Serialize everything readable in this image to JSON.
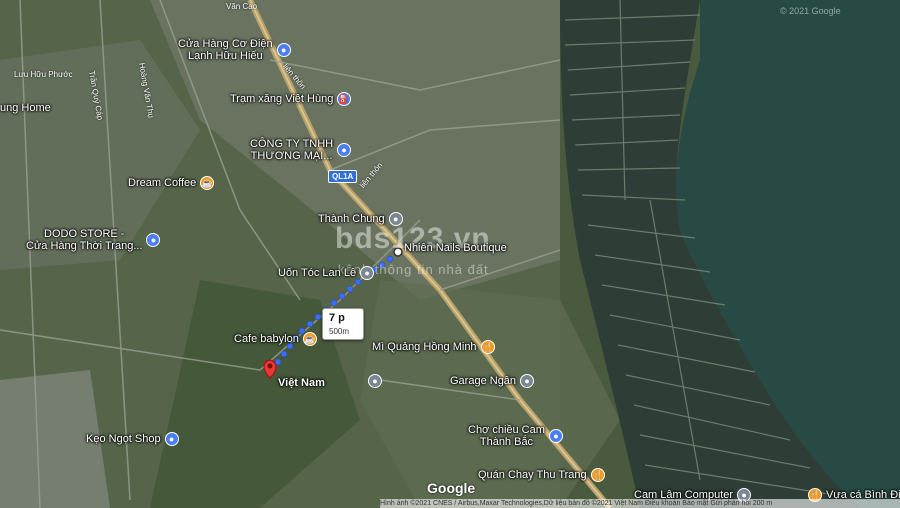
{
  "map": {
    "type": "satellite",
    "copyright_top": "© 2021 Google",
    "logo": "Google",
    "footer": "Hình ảnh ©2021 CNES / Airbus,Maxar Technologies,Dữ liệu bản đồ ©2021   Việt Nam   Điều khoản   Bảo mật   Gửi phản hồi   200 m"
  },
  "watermark": {
    "title": "bds123.vn",
    "subtitle": "kênh thông tin nhà đất"
  },
  "route": {
    "duration": "7 p",
    "distance": "500m",
    "mode_icon": "walking-icon",
    "color": "#3b6df5"
  },
  "roads": {
    "highway_shield": "QL1A",
    "lien_thon_1": "liên thôn",
    "lien_thon_2": "liên thôn",
    "van_cao": "Văn Cao",
    "luu_huu_phuoc": "Lưu Hữu Phước",
    "tran_quy_cap": "Trần Quý Cáp",
    "hoang_van_thu": "Hoàng Văn Thụ"
  },
  "pois": [
    {
      "name": "Cửa Hàng Cơ Điện\nLạnh Hữu Hiếu",
      "icon": "shopping-bag-icon",
      "kind": "shop"
    },
    {
      "name": "Trạm xăng Việt Hùng",
      "icon": "gas-station-icon",
      "kind": "shop"
    },
    {
      "name": "CÔNG TY TNHH\nTHƯƠNG MẠI...",
      "icon": "shopping-bag-icon",
      "kind": "shop"
    },
    {
      "name": "Dream Coffee",
      "icon": "coffee-icon",
      "kind": "food"
    },
    {
      "name": "DODO STORE -\nCửa Hàng Thời Trang...",
      "icon": "shopping-bag-icon",
      "kind": "shop"
    },
    {
      "name": "Thành Chung",
      "icon": "place-icon",
      "kind": "gray"
    },
    {
      "name": "Nhiên Nails Boutique",
      "icon": "place-icon",
      "kind": "gray"
    },
    {
      "name": "Uốn Tóc Lan Lê",
      "icon": "place-icon",
      "kind": "gray"
    },
    {
      "name": "Cafe babylon",
      "icon": "coffee-icon",
      "kind": "food"
    },
    {
      "name": "Mì Quảng Hồng Minh",
      "icon": "restaurant-icon",
      "kind": "food"
    },
    {
      "name": "Việt Nam",
      "icon": "red-pin-icon",
      "kind": "dest"
    },
    {
      "name": "Garage Ngân",
      "icon": "place-icon",
      "kind": "gray"
    },
    {
      "name": "Kẹo Ngọt Shop",
      "icon": "shopping-bag-icon",
      "kind": "shop"
    },
    {
      "name": "Chợ chiều Cam\nThành Bắc",
      "icon": "shopping-bag-icon",
      "kind": "shop"
    },
    {
      "name": "Quán Chay Thu Trang",
      "icon": "restaurant-icon",
      "kind": "food"
    },
    {
      "name": "Cam Lâm Computer",
      "icon": "place-icon",
      "kind": "gray"
    },
    {
      "name": "Vựa cá Bình Điền",
      "icon": "restaurant-icon",
      "kind": "food"
    },
    {
      "name": "ung Home",
      "icon": "none",
      "kind": "none"
    }
  ]
}
